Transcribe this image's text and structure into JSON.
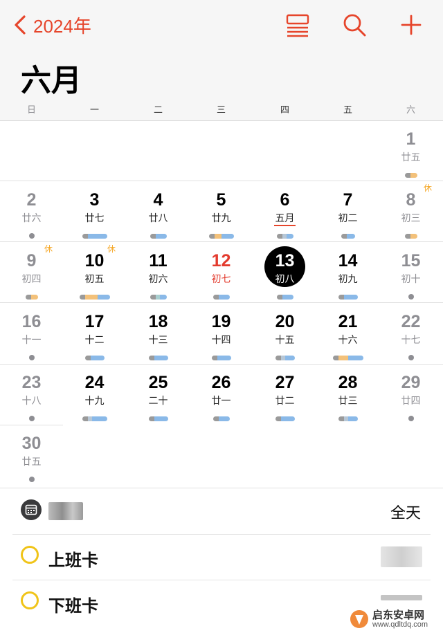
{
  "nav": {
    "back_label": "2024年",
    "accent": "#e6452b"
  },
  "toolbar": {
    "icons": [
      "list-view-icon",
      "search-icon",
      "add-icon"
    ]
  },
  "month_title": "六月",
  "weekdays": [
    "日",
    "一",
    "二",
    "三",
    "四",
    "五",
    "六"
  ],
  "days": [
    {
      "num": "1",
      "lunar": "廿五"
    },
    {
      "num": "2",
      "lunar": "廿六"
    },
    {
      "num": "3",
      "lunar": "廿七"
    },
    {
      "num": "4",
      "lunar": "廿八"
    },
    {
      "num": "5",
      "lunar": "廿九"
    },
    {
      "num": "6",
      "lunar": "五月"
    },
    {
      "num": "7",
      "lunar": "初二"
    },
    {
      "num": "8",
      "lunar": "初三",
      "badge": "休"
    },
    {
      "num": "9",
      "lunar": "初四",
      "badge": "休"
    },
    {
      "num": "10",
      "lunar": "初五",
      "badge": "休"
    },
    {
      "num": "11",
      "lunar": "初六"
    },
    {
      "num": "12",
      "lunar": "初七"
    },
    {
      "num": "13",
      "lunar": "初八"
    },
    {
      "num": "14",
      "lunar": "初九"
    },
    {
      "num": "15",
      "lunar": "初十"
    },
    {
      "num": "16",
      "lunar": "十一"
    },
    {
      "num": "17",
      "lunar": "十二"
    },
    {
      "num": "18",
      "lunar": "十三"
    },
    {
      "num": "19",
      "lunar": "十四"
    },
    {
      "num": "20",
      "lunar": "十五"
    },
    {
      "num": "21",
      "lunar": "十六"
    },
    {
      "num": "22",
      "lunar": "十七"
    },
    {
      "num": "23",
      "lunar": "十八"
    },
    {
      "num": "24",
      "lunar": "十九"
    },
    {
      "num": "25",
      "lunar": "二十"
    },
    {
      "num": "26",
      "lunar": "廿一"
    },
    {
      "num": "27",
      "lunar": "廿二"
    },
    {
      "num": "28",
      "lunar": "廿三"
    },
    {
      "num": "29",
      "lunar": "廿四"
    },
    {
      "num": "30",
      "lunar": "廿五"
    }
  ],
  "events": {
    "all_day_label": "全天",
    "items": [
      {
        "title": "上班卡"
      },
      {
        "title": "下班卡"
      }
    ]
  },
  "watermark": {
    "name": "启东安卓网",
    "url": "www.qdltdq.com"
  }
}
